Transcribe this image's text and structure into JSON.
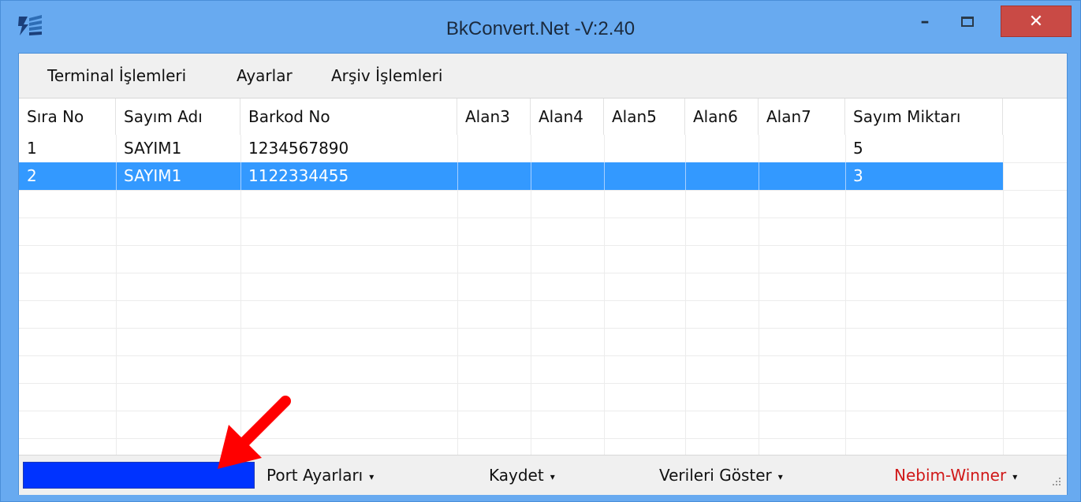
{
  "window": {
    "title": "BkConvert.Net -V:2.40",
    "minimize": "–",
    "close": "✕"
  },
  "menu": [
    {
      "label": "Terminal İşlemleri"
    },
    {
      "label": "Ayarlar"
    },
    {
      "label": "Arşiv İşlemleri"
    }
  ],
  "grid": {
    "columns": [
      "Sıra No",
      "Sayım Adı",
      "Barkod No",
      "Alan3",
      "Alan4",
      "Alan5",
      "Alan6",
      "Alan7",
      "Sayım Miktarı"
    ],
    "rows": [
      [
        "1",
        "SAYIM1",
        "1234567890",
        "",
        "",
        "",
        "",
        "",
        "5"
      ],
      [
        "2",
        "SAYIM1",
        "1122334455",
        "",
        "",
        "",
        "",
        "",
        "3"
      ]
    ],
    "selected_row": 2
  },
  "statusbar": {
    "progress_percent": 100,
    "port_settings": "Port Ayarları",
    "save": "Kaydet",
    "show_data": "Verileri Göster",
    "nebim": "Nebim-Winner",
    "caret": "▾"
  },
  "colors": {
    "titlebar": "#68aaf0",
    "close_button": "#c94a45",
    "selection": "#3399ff",
    "progress": "#0033ff",
    "nebim_text": "#d01818",
    "annotation_arrow": "#ff0000"
  },
  "icons": {
    "app": "app-icon",
    "annotation": "red-arrow-icon"
  }
}
